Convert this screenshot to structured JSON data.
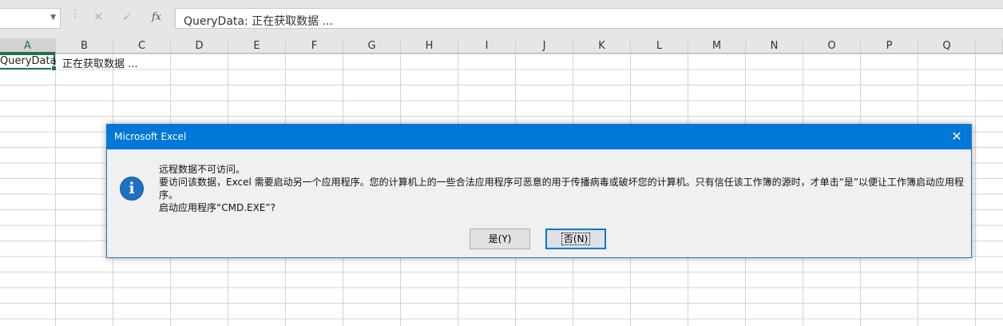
{
  "formula_bar": {
    "name_box": "",
    "name_box_arrow": "▼",
    "separator": "⋮",
    "cancel_glyph": "✕",
    "enter_glyph": "✓",
    "fx_label": "fx",
    "formula": "QueryData: 正在获取数据 ..."
  },
  "sheet": {
    "columns": [
      "A",
      "B",
      "C",
      "D",
      "E",
      "F",
      "G",
      "H",
      "I",
      "J",
      "K",
      "L",
      "M",
      "N",
      "O",
      "P",
      "Q"
    ],
    "selected_column": "A",
    "cells": {
      "A1": "QueryData",
      "B1": "正在获取数据 ..."
    },
    "accent_color": "#217346"
  },
  "dialog": {
    "title": "Microsoft Excel",
    "close_glyph": "✕",
    "icon": "info-icon",
    "icon_glyph": "i",
    "lines": [
      "远程数据不可访问。",
      "要访问该数据，Excel 需要启动另一个应用程序。您的计算机上的一些合法应用程序可恶意的用于传播病毒或破坏您的计算机。只有信任该工作簿的源时，才单击“是”以便让工作簿启动应用程序。",
      "启动应用程序“CMD.EXE”?"
    ],
    "yes_button": "是(Y)",
    "no_button": "否(N)",
    "title_color": "#0078d7"
  }
}
